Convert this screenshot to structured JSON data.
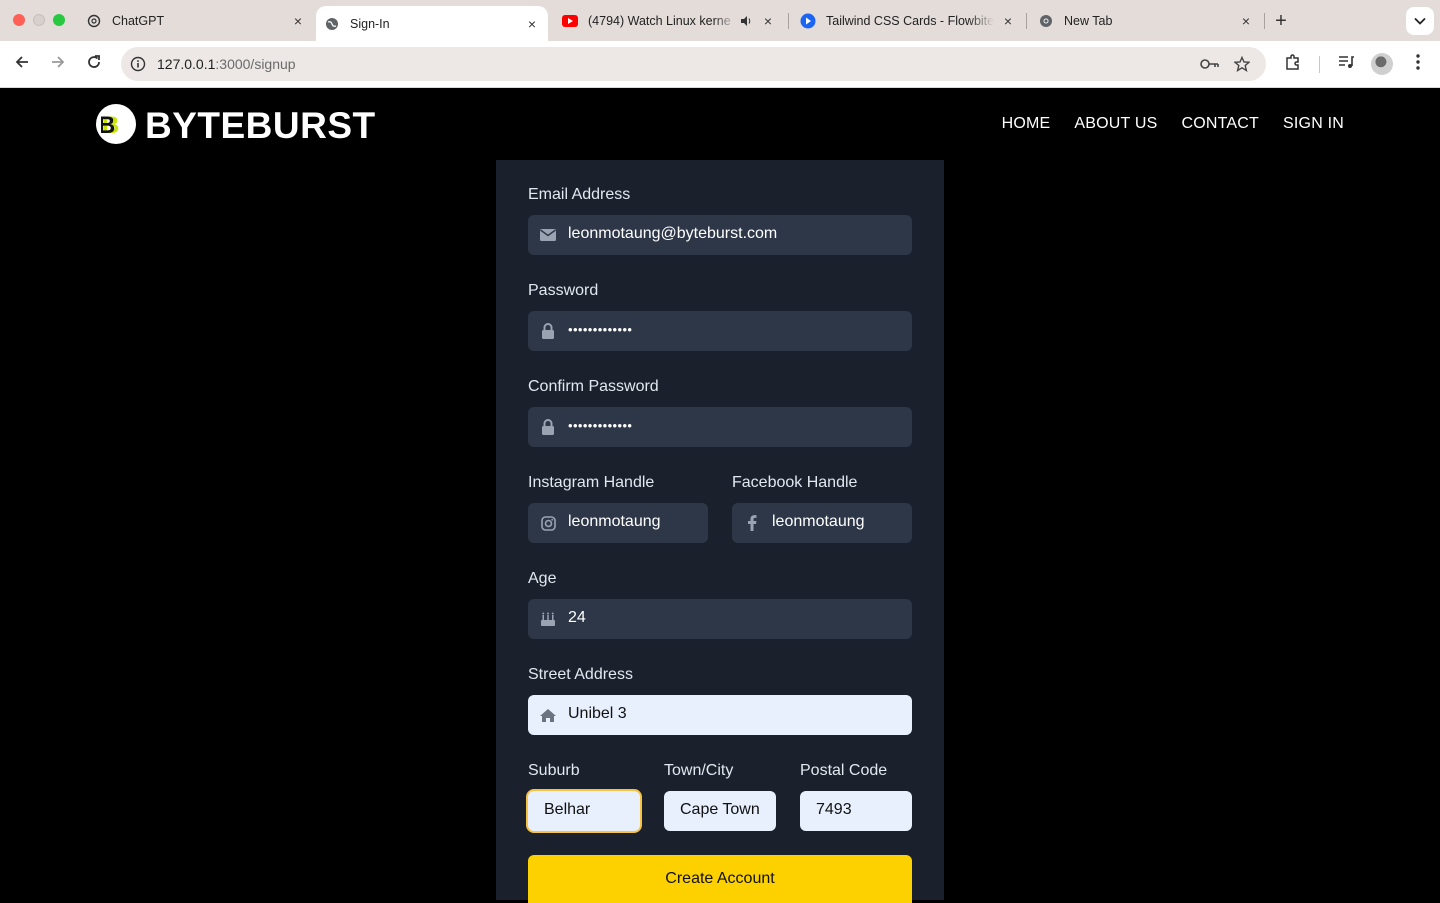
{
  "browser": {
    "tabs": [
      {
        "title": "ChatGPT",
        "icon": "chatgpt-icon",
        "close": "×"
      },
      {
        "title": "Sign-In",
        "icon": "globe-icon",
        "close": "×",
        "active": true
      },
      {
        "title": "(4794) Watch Linux kerne",
        "icon": "youtube-icon",
        "close": "×",
        "audio": true
      },
      {
        "title": "Tailwind CSS Cards - Flowbite",
        "icon": "flowbite-icon",
        "close": "×"
      },
      {
        "title": "New Tab",
        "icon": "chrome-icon",
        "close": "×"
      }
    ],
    "new_tab": "+",
    "url_host": "127.0.0.1",
    "url_rest": ":3000/signup"
  },
  "header": {
    "logo_text": "BYTEBURST",
    "nav": [
      "HOME",
      "ABOUT US",
      "CONTACT",
      "SIGN IN"
    ]
  },
  "form": {
    "email": {
      "label": "Email Address",
      "value": "leonmotaung@byteburst.com",
      "icon": "envelope-icon"
    },
    "password": {
      "label": "Password",
      "value": "•••••••••••••",
      "icon": "lock-icon"
    },
    "confirm_password": {
      "label": "Confirm Password",
      "value": "•••••••••••••",
      "icon": "lock-icon"
    },
    "instagram": {
      "label": "Instagram Handle",
      "value": "leonmotaung",
      "icon": "instagram-icon"
    },
    "facebook": {
      "label": "Facebook Handle",
      "value": "leonmotaung",
      "icon": "facebook-icon"
    },
    "age": {
      "label": "Age",
      "value": "24",
      "icon": "birthday-cake-icon"
    },
    "street": {
      "label": "Street Address",
      "value": "Unibel 3",
      "icon": "home-icon"
    },
    "suburb": {
      "label": "Suburb",
      "value": "Belhar"
    },
    "town": {
      "label": "Town/City",
      "value": "Cape Town"
    },
    "postal": {
      "label": "Postal Code",
      "value": "7493"
    },
    "submit": "Create Account"
  },
  "colors": {
    "page_bg": "#000000",
    "card_bg": "#1a202c",
    "input_bg": "#2d3748",
    "autofill_bg": "#e8f0fe",
    "accent": "#fdd000"
  }
}
